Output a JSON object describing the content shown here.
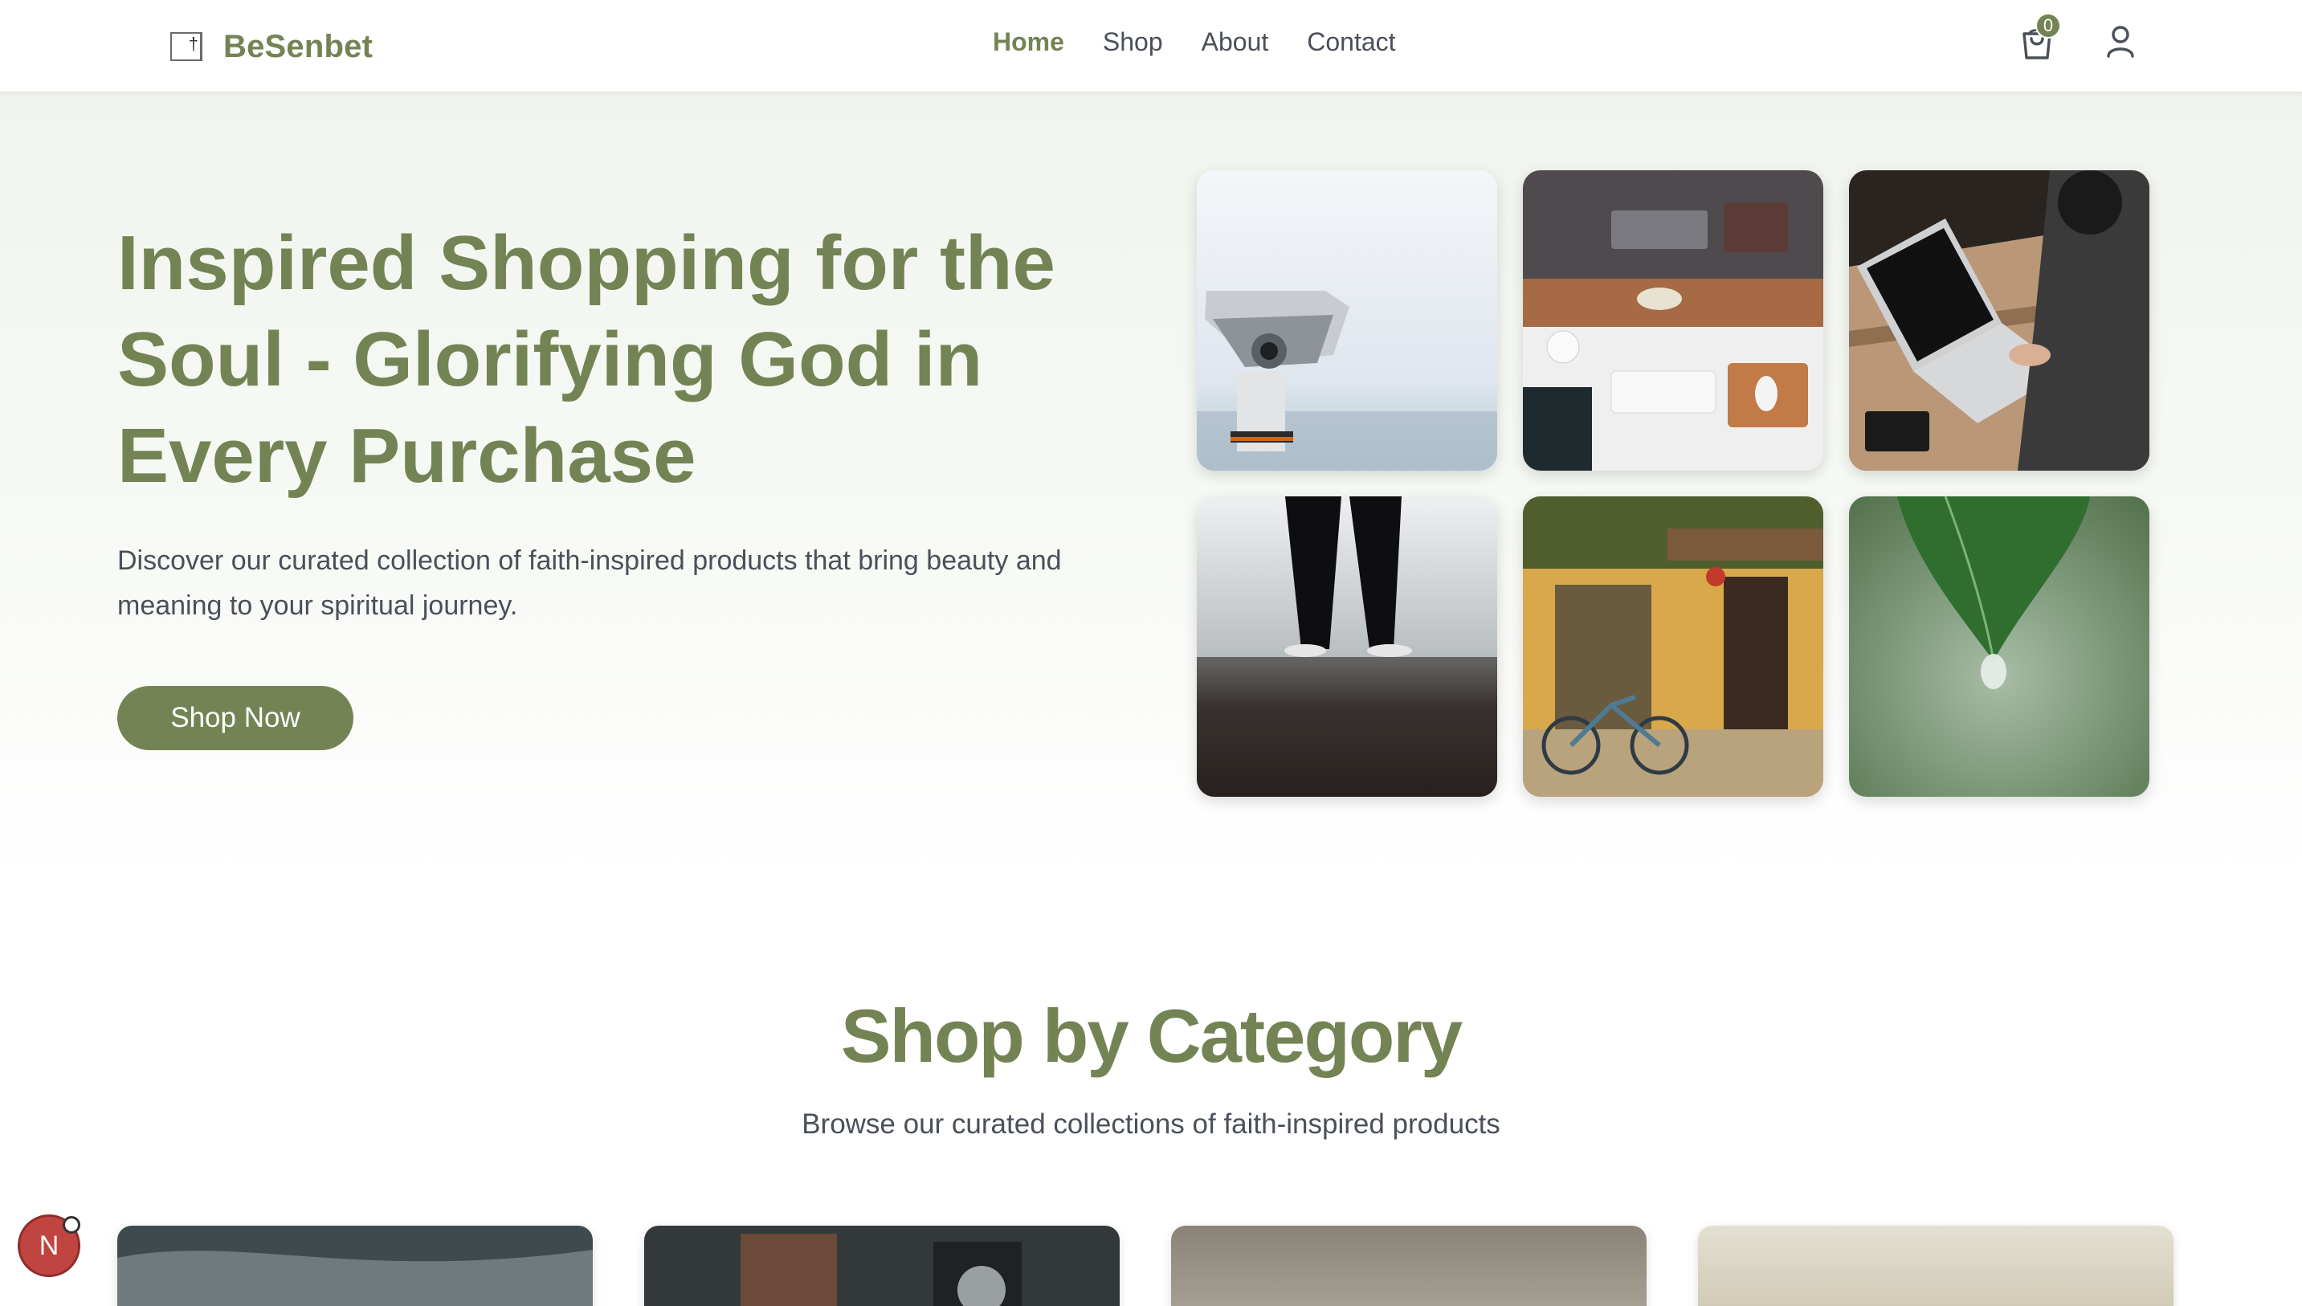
{
  "header": {
    "brand": "BeSenbet",
    "logo_icon": "cross-logo-icon",
    "nav": [
      {
        "label": "Home",
        "active": true
      },
      {
        "label": "Shop",
        "active": false
      },
      {
        "label": "About",
        "active": false
      },
      {
        "label": "Contact",
        "active": false
      }
    ],
    "cart_icon": "shopping-bag-icon",
    "cart_count": "0",
    "user_icon": "user-icon"
  },
  "hero": {
    "title": "Inspired Shopping for the Soul - Glorifying God in Every Purchase",
    "description": "Discover our curated collection of faith-inspired products that bring beauty and meaning to your spiritual journey.",
    "cta_label": "Shop Now",
    "gallery": [
      "binoculars-viewer-photo",
      "desk-workspace-photo",
      "laptop-typing-photo",
      "person-standing-photo",
      "yellow-house-bicycle-photo",
      "leaf-water-drop-photo"
    ]
  },
  "categories": {
    "title": "Shop by Category",
    "subtitle": "Browse our curated collections of faith-inspired products",
    "cards": [
      "category-card-1",
      "category-card-2",
      "category-card-3",
      "category-card-4"
    ]
  },
  "floating": {
    "notification_letter": "N"
  },
  "colors": {
    "brand": "#748354",
    "text": "#4a5059",
    "hero_bg": "#f1f4ee"
  }
}
